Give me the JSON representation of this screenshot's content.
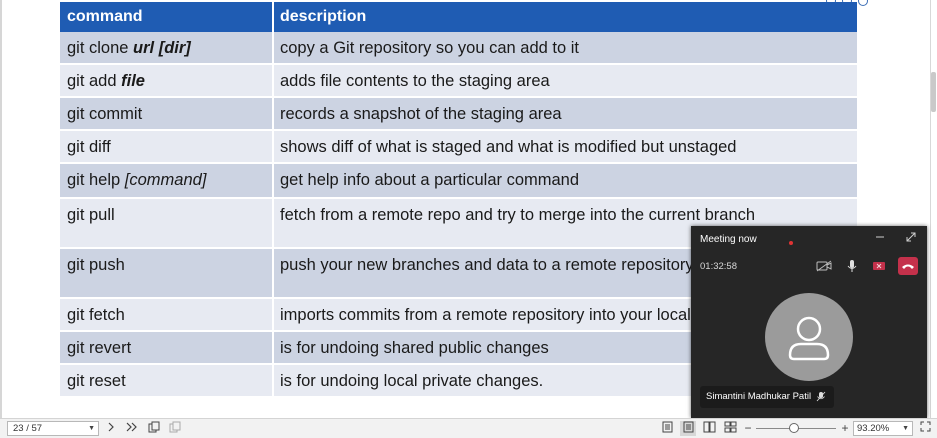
{
  "table": {
    "headers": [
      "command",
      "description"
    ],
    "rows": [
      {
        "cmd_pre": "git clone ",
        "cmd_em": "url  [dir]",
        "cmd_em_style": "bi",
        "desc": "copy a Git repository so you can add to it"
      },
      {
        "cmd_pre": "git add ",
        "cmd_em": "file",
        "cmd_em_style": "bi",
        "desc": "adds file contents to the staging area"
      },
      {
        "cmd_pre": "git commit",
        "cmd_em": "",
        "cmd_em_style": "",
        "desc": "records a snapshot of the staging area"
      },
      {
        "cmd_pre": "git diff",
        "cmd_em": "",
        "cmd_em_style": "",
        "desc": "shows diff of what is staged and what is modified but unstaged"
      },
      {
        "cmd_pre": "git help ",
        "cmd_em": "[command]",
        "cmd_em_style": "it",
        "desc": "get help info about a particular command"
      },
      {
        "cmd_pre": "git pull",
        "cmd_em": "",
        "cmd_em_style": "",
        "desc": "fetch from a remote repo and try to merge into the current branch"
      },
      {
        "cmd_pre": "git push",
        "cmd_em": "",
        "cmd_em_style": "",
        "desc": "push your new branches and data to a remote repository"
      },
      {
        "cmd_pre": "git fetch",
        "cmd_em": "",
        "cmd_em_style": "",
        "desc": "imports commits from a remote repository into your local repo"
      },
      {
        "cmd_pre": "git revert",
        "cmd_em": "",
        "cmd_em_style": "",
        "desc": "is for undoing shared public changes"
      },
      {
        "cmd_pre": "git reset",
        "cmd_em": "",
        "cmd_em_style": "",
        "desc": "is for undoing local private changes."
      }
    ]
  },
  "meeting": {
    "title": "Meeting now",
    "timer": "01:32:58",
    "participant": "Simantini Madhukar Patil",
    "icons": [
      "minimize-icon",
      "expand-icon",
      "camera-off-icon",
      "microphone-icon",
      "share-icon",
      "hang-up-icon",
      "person-icon",
      "mic-muted-icon"
    ],
    "hangup_color": "#c4314b"
  },
  "statusbar": {
    "page": "23 / 57",
    "zoom_minus": "−",
    "zoom_plus": "+",
    "zoom": "93.20%"
  },
  "colors": {
    "header_bg": "#1f5cb3",
    "row_dark": "#ccd3e2",
    "row_light": "#e7eaf2"
  }
}
